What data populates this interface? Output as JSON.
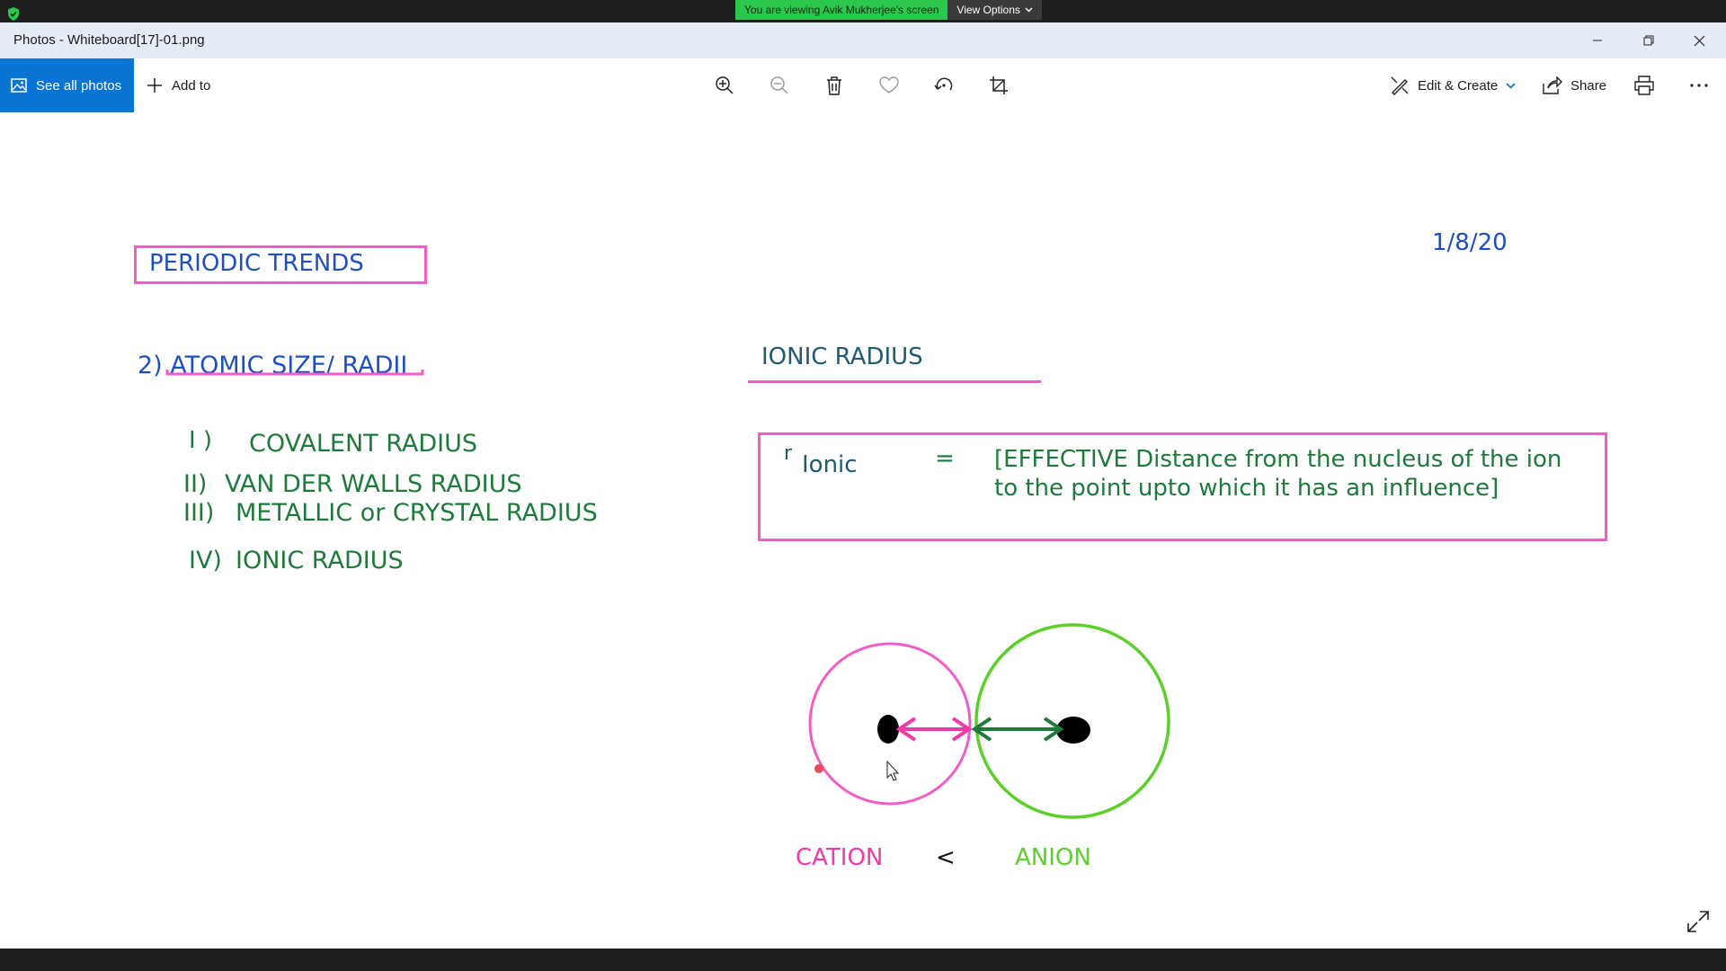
{
  "share": {
    "message": "You are viewing Avik Mukherjee's screen",
    "view_options": "View Options"
  },
  "window": {
    "title": "Photos - Whiteboard[17]-01.png"
  },
  "toolbar": {
    "see_all": "See all photos",
    "add_to": "Add to",
    "edit_create": "Edit & Create",
    "share": "Share",
    "tools": [
      "zoom-in-icon",
      "zoom-out-icon",
      "trash-icon",
      "heart-icon",
      "rotate-icon",
      "crop-icon",
      "print-icon",
      "more-icon"
    ]
  },
  "whiteboard": {
    "heading": "PERIODIC TRENDS",
    "date": "1/8/20",
    "section": "2) ATOMIC SIZE/ RADII",
    "list": [
      {
        "num": "I )",
        "text": "COVALENT RADIUS"
      },
      {
        "num": "II)",
        "text": "VAN DER WALLS RADIUS"
      },
      {
        "num": "III)",
        "text": "METALLIC or CRYSTAL  RADIUS"
      },
      {
        "num": "IV)",
        "text": "IONIC RADIUS"
      }
    ],
    "ionic_title": "IONIC RADIUS",
    "formula": {
      "symbol": "r",
      "subscript": "Ionic",
      "equals": "=",
      "line1": "[EFFECTIVE Distance from the nucleus of the ion",
      "line2": "to the point upto which it has an influence]"
    },
    "cation": "CATION",
    "less_than": "<",
    "anion": "ANION"
  },
  "colors": {
    "accent": "#0a74d4",
    "pink": "#f25cc5",
    "blue_ink": "#1f4fbf",
    "green_ink": "#1e7a3a",
    "light_green": "#5ccf2a"
  }
}
